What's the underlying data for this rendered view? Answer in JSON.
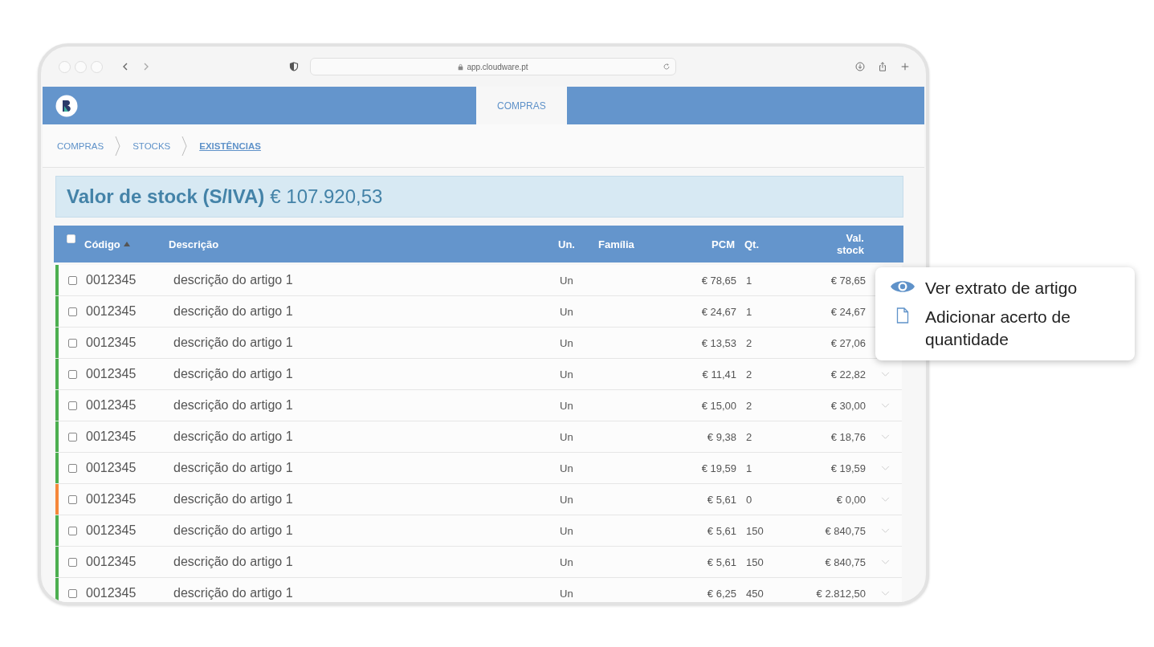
{
  "browser": {
    "url": "app.cloudware.pt"
  },
  "app_nav": {
    "tabs": [
      {
        "label": "COMPRAS",
        "selected": true
      }
    ]
  },
  "breadcrumb": [
    {
      "label": "COMPRAS",
      "current": false
    },
    {
      "label": "STOCKS",
      "current": false
    },
    {
      "label": "EXISTÊNCIAS",
      "current": true
    }
  ],
  "summary": {
    "label": "Valor de stock (S/IVA)",
    "value": "€ 107.920,53"
  },
  "table": {
    "select_all": {
      "checked": false
    },
    "columns": [
      {
        "label": "Código",
        "sorted": true
      },
      {
        "label": "Descrição",
        "sorted": false
      },
      {
        "label": "Un.",
        "sorted": false
      },
      {
        "label": "Família",
        "sorted": false
      },
      {
        "label": "PCM",
        "sorted": false
      },
      {
        "label": "Qt.",
        "sorted": false
      },
      {
        "label": "Val. stock",
        "sorted": false
      }
    ],
    "rows": [
      {
        "color": "#4caf50",
        "checked": false,
        "code": "0012345",
        "description": "descrição do artigo 1",
        "unit": "Un",
        "family": "",
        "pcm": "€ 78,65",
        "qty": "1",
        "value": "€ 78,65"
      },
      {
        "color": "#4caf50",
        "checked": false,
        "code": "0012345",
        "description": "descrição do artigo 1",
        "unit": "Un",
        "family": "",
        "pcm": "€ 24,67",
        "qty": "1",
        "value": "€ 24,67"
      },
      {
        "color": "#4caf50",
        "checked": false,
        "code": "0012345",
        "description": "descrição do artigo 1",
        "unit": "Un",
        "family": "",
        "pcm": "€ 13,53",
        "qty": "2",
        "value": "€ 27,06"
      },
      {
        "color": "#4caf50",
        "checked": false,
        "code": "0012345",
        "description": "descrição do artigo 1",
        "unit": "Un",
        "family": "",
        "pcm": "€ 11,41",
        "qty": "2",
        "value": "€ 22,82"
      },
      {
        "color": "#4caf50",
        "checked": false,
        "code": "0012345",
        "description": "descrição do artigo 1",
        "unit": "Un",
        "family": "",
        "pcm": "€ 15,00",
        "qty": "2",
        "value": "€ 30,00"
      },
      {
        "color": "#4caf50",
        "checked": false,
        "code": "0012345",
        "description": "descrição do artigo 1",
        "unit": "Un",
        "family": "",
        "pcm": "€ 9,38",
        "qty": "2",
        "value": "€ 18,76"
      },
      {
        "color": "#4caf50",
        "checked": false,
        "code": "0012345",
        "description": "descrição do artigo 1",
        "unit": "Un",
        "family": "",
        "pcm": "€ 19,59",
        "qty": "1",
        "value": "€ 19,59"
      },
      {
        "color": "#f5883a",
        "checked": false,
        "code": "0012345",
        "description": "descrição do artigo 1",
        "unit": "Un",
        "family": "",
        "pcm": "€ 5,61",
        "qty": "0",
        "value": "€ 0,00"
      },
      {
        "color": "#4caf50",
        "checked": false,
        "code": "0012345",
        "description": "descrição do artigo 1",
        "unit": "Un",
        "family": "",
        "pcm": "€ 5,61",
        "qty": "150",
        "value": "€ 840,75"
      },
      {
        "color": "#4caf50",
        "checked": false,
        "code": "0012345",
        "description": "descrição do artigo 1",
        "unit": "Un",
        "family": "",
        "pcm": "€ 5,61",
        "qty": "150",
        "value": "€ 840,75"
      },
      {
        "color": "#4caf50",
        "checked": false,
        "code": "0012345",
        "description": "descrição do artigo 1",
        "unit": "Un",
        "family": "",
        "pcm": "€ 6,25",
        "qty": "450",
        "value": "€ 2.812,50"
      }
    ]
  },
  "context_menu": {
    "items": [
      {
        "kind": "view",
        "label": "Ver extrato de artigo"
      },
      {
        "kind": "document",
        "label": "Adicionar acerto de quantidade"
      }
    ]
  }
}
